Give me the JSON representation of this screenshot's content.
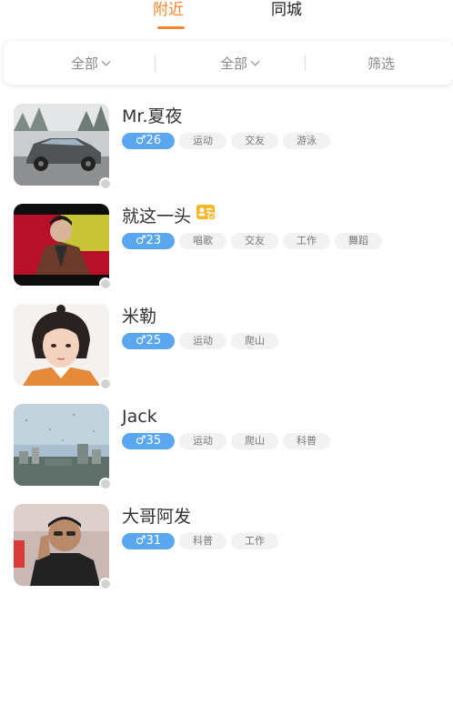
{
  "tabs": [
    {
      "label": "附近",
      "active": true
    },
    {
      "label": "同城",
      "active": false
    }
  ],
  "filters": [
    {
      "label": "全部",
      "dropdown": true
    },
    {
      "label": "全部",
      "dropdown": true
    },
    {
      "label": "筛选",
      "dropdown": false
    }
  ],
  "colors": {
    "accent": "#f5882a",
    "gender_male": "#5ba7ef",
    "tag_bg": "#f2f2f2",
    "online_dot": "#d3d3d3"
  },
  "users": [
    {
      "name": "Mr.夏夜",
      "gender_symbol": "♂",
      "age": "26",
      "tags": [
        "运动",
        "交友",
        "游泳"
      ],
      "verified": false,
      "avatar": "car-photo"
    },
    {
      "name": "就这一头",
      "gender_symbol": "♂",
      "age": "23",
      "tags": [
        "唱歌",
        "交友",
        "工作",
        "舞蹈"
      ],
      "verified": true,
      "avatar": "man-on-red-photo"
    },
    {
      "name": "米勒",
      "gender_symbol": "♂",
      "age": "25",
      "tags": [
        "运动",
        "爬山"
      ],
      "verified": false,
      "avatar": "illustrated-portrait"
    },
    {
      "name": "Jack",
      "gender_symbol": "♂",
      "age": "35",
      "tags": [
        "运动",
        "爬山",
        "科普"
      ],
      "verified": false,
      "avatar": "city-window-photo"
    },
    {
      "name": "大哥阿发",
      "gender_symbol": "♂",
      "age": "31",
      "tags": [
        "科普",
        "工作"
      ],
      "verified": false,
      "avatar": "man-on-phone-photo"
    }
  ]
}
